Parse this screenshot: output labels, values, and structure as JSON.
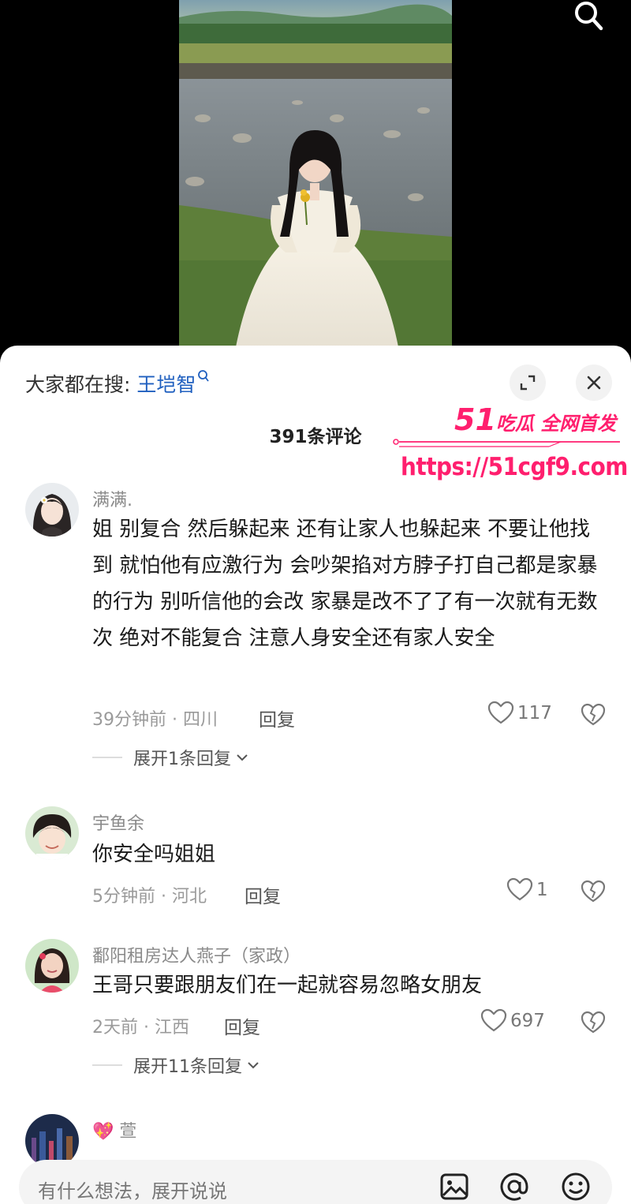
{
  "header": {
    "hot_search_prefix": "大家都在搜:",
    "hot_search_keyword": "王垲智",
    "comment_count": "391条评论"
  },
  "watermark": {
    "brand_number": "51",
    "brand_text": "吃瓜 全网首发",
    "url": "https://51cgf9.com"
  },
  "comments": [
    {
      "username": "满满.",
      "text": "姐 别复合 然后躲起来 还有让家人也躲起来 不要让他找到 就怕他有应激行为 会吵架掐对方脖子打自己都是家暴的行为 别听信他的会改 家暴是改不了了有一次就有无数次 绝对不能复合 注意人身安全还有家人安全",
      "meta": "39分钟前 · 四川",
      "reply_label": "回复",
      "likes": "117",
      "expand_label": "展开1条回复"
    },
    {
      "username": "宇鱼余",
      "text": "你安全吗姐姐",
      "meta": "5分钟前 · 河北",
      "reply_label": "回复",
      "likes": "1"
    },
    {
      "username": "鄱阳租房达人燕子（家政）",
      "text": "王哥只要跟朋友们在一起就容易忽略女朋友",
      "meta": "2天前 · 江西",
      "reply_label": "回复",
      "likes": "697",
      "expand_label": "展开11条回复"
    },
    {
      "username": "萱",
      "emoji": "💖"
    }
  ],
  "input_bar": {
    "placeholder": "有什么想法，展开说说"
  },
  "icons": {
    "search": "search-icon",
    "expand": "expand-icon",
    "close": "close-icon",
    "like": "heart-icon",
    "dislike": "broken-heart-icon",
    "image": "image-icon",
    "mention": "at-icon",
    "emoji": "smile-icon"
  },
  "colors": {
    "link_blue": "#1f5fbf",
    "watermark_pink": "#ff1f6e",
    "sheet_bg": "#ffffff",
    "video_bg": "#000000"
  }
}
